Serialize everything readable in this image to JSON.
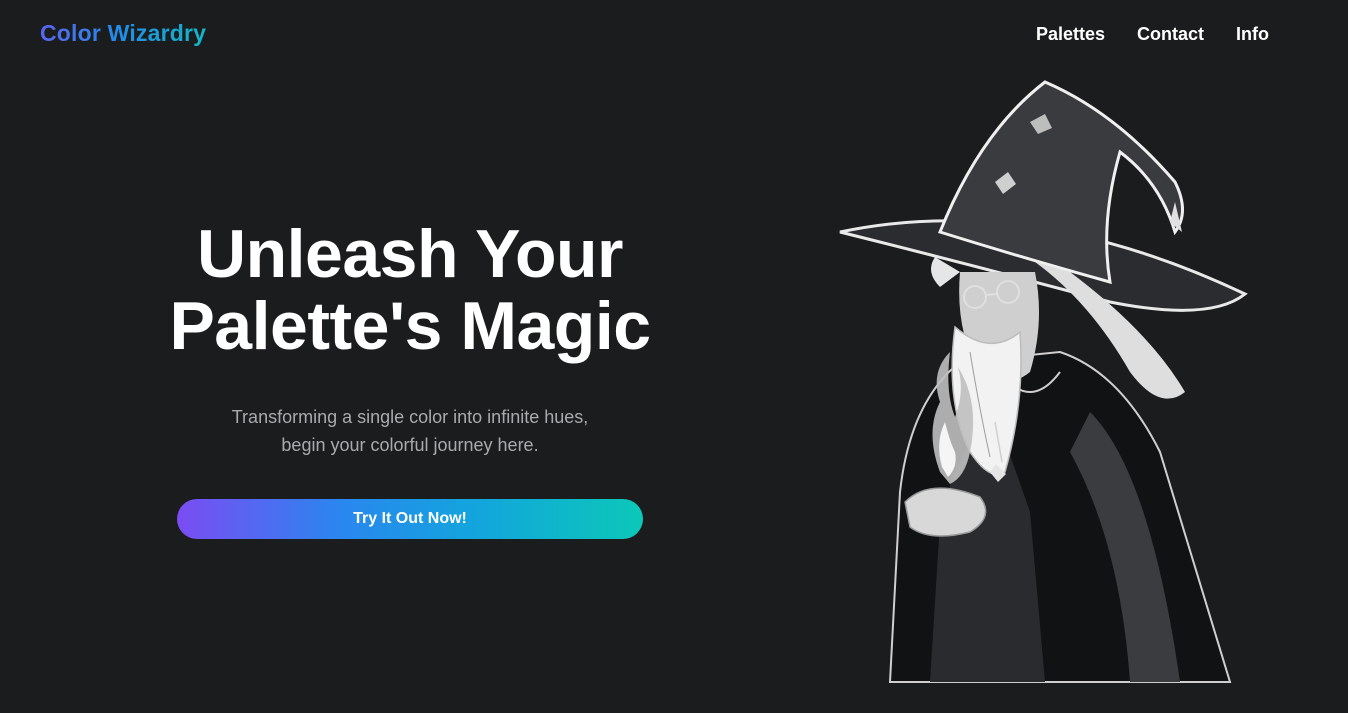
{
  "brand": {
    "name": "Color Wizardry"
  },
  "nav": {
    "items": [
      {
        "label": "Palettes"
      },
      {
        "label": "Contact"
      },
      {
        "label": "Info"
      }
    ]
  },
  "hero": {
    "title_line1": "Unleash Your",
    "title_line2": "Palette's Magic",
    "subtitle_line1": "Transforming a single color into infinite hues,",
    "subtitle_line2": "begin your colorful journey here.",
    "cta_label": "Try It Out Now!"
  },
  "colors": {
    "background": "#1b1c1e",
    "gradient_start": "#7b4cf2",
    "gradient_mid": "#2a86f0",
    "gradient_end": "#0cc8b8"
  },
  "illustration": {
    "icon": "wizard-illustration"
  }
}
